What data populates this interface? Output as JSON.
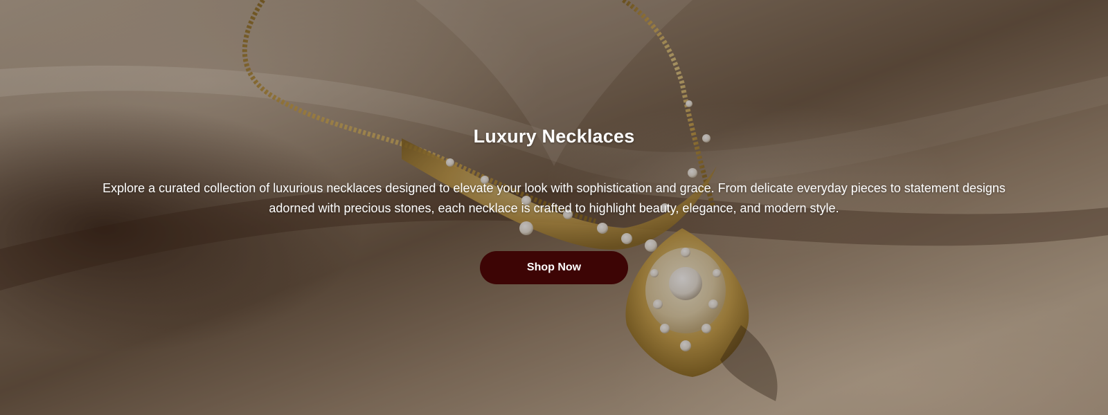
{
  "hero": {
    "title": "Luxury Necklaces",
    "description": "Explore a curated collection of luxurious necklaces designed to elevate your look with sophistication and grace. From delicate everyday pieces to statement designs adorned with precious stones, each necklace is crafted to highlight beauty, elegance, and modern style.",
    "cta_label": "Shop Now",
    "background_image": "gold-diamond-necklace-on-satin",
    "colors": {
      "text": "#ffffff",
      "cta_background": "#3d0505",
      "overlay": "#140c06"
    }
  }
}
